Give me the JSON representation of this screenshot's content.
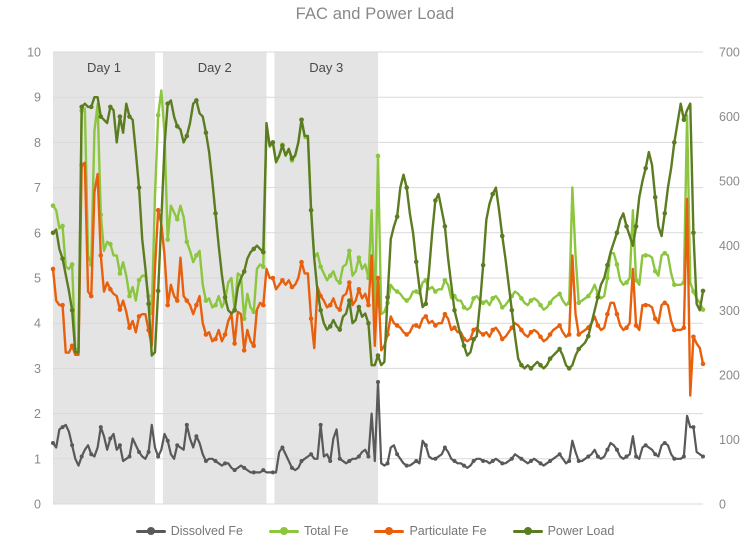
{
  "chart": {
    "title": "FAC and Power Load",
    "title_color": "#888888"
  },
  "axes": {
    "left": {
      "ticks": [
        "0",
        "1",
        "2",
        "3",
        "4",
        "5",
        "6",
        "7",
        "8",
        "9",
        "10"
      ],
      "min": 0,
      "max": 10,
      "step": 1
    },
    "right": {
      "ticks": [
        "0",
        "100",
        "200",
        "300",
        "400",
        "500",
        "600",
        "700"
      ],
      "min": 0,
      "max": 700,
      "step": 100
    }
  },
  "bands": [
    {
      "label": "Day 1",
      "x_start": 0,
      "x_end": 32
    },
    {
      "label": "Day 2",
      "x_start": 34.5,
      "x_end": 67
    },
    {
      "label": "Day 3",
      "x_start": 69.5,
      "x_end": 102
    }
  ],
  "band_color": "#e4e4e4",
  "legend": {
    "position": "bottom",
    "items": [
      {
        "label": "Dissolved Fe",
        "color": "#595959"
      },
      {
        "label": "Total Fe",
        "color": "#8CC63E"
      },
      {
        "label": "Particulate Fe",
        "color": "#E8600D"
      },
      {
        "label": "Power Load",
        "color": "#5C7C22"
      }
    ]
  },
  "chart_data": {
    "type": "line",
    "title": "FAC and Power Load",
    "xlabel": "",
    "ylabel": "",
    "ylim": [
      0,
      10
    ],
    "y2lim": [
      0,
      700
    ],
    "grid": true,
    "legend_position": "bottom",
    "annotations": [
      "Day 1",
      "Day 2",
      "Day 3"
    ],
    "series": [
      {
        "name": "Total Fe",
        "color": "#8CC63E",
        "axis": "left",
        "values": [
          6.6,
          6.5,
          6.1,
          6.15,
          5.25,
          5.2,
          5.3,
          3.4,
          3.45,
          8.7,
          8.75,
          5.5,
          5.3,
          8.25,
          8.85,
          6.4,
          5.6,
          5.8,
          5.75,
          5.5,
          5.5,
          5.1,
          5.35,
          5.05,
          4.6,
          4.8,
          4.5,
          4.95,
          5.05,
          5.05,
          4.6,
          4.2,
          6.8,
          8.6,
          9.15,
          8.2,
          5.85,
          6.6,
          6.45,
          6.3,
          6.6,
          6.35,
          5.8,
          5.6,
          5.35,
          5.5,
          5.6,
          4.85,
          4.5,
          4.55,
          4.35,
          4.4,
          4.6,
          4.35,
          4.5,
          4.9,
          5.0,
          4.3,
          5.1,
          5.05,
          4.1,
          4.65,
          4.35,
          4.25,
          5.2,
          5.3,
          5.25,
          8.35,
          7.9,
          8.0,
          7.55,
          7.7,
          7.95,
          7.7,
          7.85,
          7.6,
          7.7,
          8.0,
          8.5,
          8.1,
          8.1,
          6.5,
          5.45,
          5.55,
          5.25,
          5.1,
          4.95,
          5.05,
          5.15,
          4.95,
          4.9,
          5.25,
          5.3,
          5.6,
          5.05,
          5.15,
          5.45,
          5.2,
          5.3,
          5.0,
          6.5,
          4.2,
          7.7,
          4.2,
          4.25,
          4.45,
          4.85,
          4.75,
          4.7,
          4.65,
          4.55,
          4.5,
          4.55,
          4.7,
          4.7,
          4.65,
          4.9,
          4.95,
          4.75,
          4.8,
          4.7,
          4.75,
          4.75,
          4.95,
          4.85,
          4.55,
          4.6,
          4.5,
          4.5,
          4.35,
          4.3,
          4.35,
          4.55,
          4.6,
          4.5,
          4.45,
          4.5,
          4.4,
          4.55,
          4.6,
          4.5,
          4.35,
          4.4,
          4.5,
          4.6,
          4.7,
          4.65,
          4.55,
          4.45,
          4.4,
          4.5,
          4.55,
          4.5,
          4.4,
          4.3,
          4.35,
          4.45,
          4.55,
          4.6,
          4.65,
          4.5,
          4.4,
          4.45,
          7.0,
          5.5,
          4.45,
          4.5,
          4.55,
          4.6,
          4.7,
          4.85,
          4.65,
          4.55,
          4.6,
          5.0,
          5.55,
          5.55,
          5.3,
          4.95,
          4.85,
          4.9,
          5.0,
          6.5,
          4.95,
          4.85,
          5.5,
          5.5,
          5.5,
          5.45,
          5.15,
          5.05,
          5.5,
          5.55,
          5.5,
          5.1,
          4.85,
          4.85,
          4.85,
          4.9,
          8.6,
          4.9,
          4.7,
          4.55,
          4.45,
          4.3
        ]
      },
      {
        "name": "Particulate Fe",
        "color": "#E8600D",
        "axis": "left",
        "values": [
          5.2,
          4.5,
          4.4,
          4.4,
          3.35,
          3.35,
          3.5,
          3.3,
          3.3,
          7.5,
          7.55,
          4.7,
          4.6,
          6.9,
          7.3,
          5.5,
          4.7,
          4.9,
          4.75,
          4.65,
          4.6,
          4.3,
          4.5,
          4.25,
          3.9,
          4.05,
          3.8,
          4.15,
          4.2,
          4.2,
          3.85,
          3.5,
          5.2,
          6.5,
          6.2,
          5.5,
          4.4,
          4.85,
          4.6,
          4.5,
          5.45,
          4.6,
          4.5,
          4.4,
          4.2,
          4.4,
          4.6,
          4.0,
          3.75,
          3.8,
          3.6,
          3.65,
          3.85,
          3.6,
          3.75,
          4.05,
          4.2,
          3.55,
          4.25,
          4.2,
          3.4,
          3.85,
          3.6,
          3.5,
          4.3,
          4.45,
          4.4,
          5.2,
          5.0,
          5.0,
          4.75,
          4.85,
          4.95,
          4.85,
          4.95,
          4.8,
          4.85,
          5.0,
          5.35,
          5.1,
          5.1,
          4.1,
          3.45,
          4.8,
          4.6,
          4.5,
          4.35,
          4.4,
          4.55,
          4.35,
          4.3,
          4.6,
          4.65,
          4.9,
          4.4,
          4.5,
          4.75,
          4.55,
          4.65,
          4.4,
          5.5,
          3.5,
          5.0,
          3.4,
          3.5,
          3.75,
          4.15,
          4.0,
          3.95,
          3.9,
          3.8,
          3.75,
          3.8,
          3.95,
          3.95,
          3.9,
          4.1,
          4.15,
          4.0,
          4.05,
          3.95,
          4.0,
          4.0,
          4.2,
          4.1,
          3.85,
          3.9,
          3.8,
          3.8,
          3.65,
          3.6,
          3.65,
          3.85,
          3.9,
          3.8,
          3.75,
          3.8,
          3.7,
          3.85,
          3.9,
          3.8,
          3.65,
          3.7,
          3.8,
          3.9,
          4.0,
          3.95,
          3.85,
          3.75,
          3.7,
          3.8,
          3.85,
          3.8,
          3.7,
          3.6,
          3.65,
          3.75,
          3.85,
          3.9,
          3.95,
          3.8,
          3.7,
          3.75,
          5.5,
          4.2,
          3.75,
          3.8,
          3.85,
          3.9,
          4.0,
          4.15,
          3.95,
          3.85,
          3.9,
          4.2,
          4.45,
          4.45,
          4.2,
          3.95,
          3.85,
          3.9,
          4.0,
          5.2,
          3.95,
          3.85,
          4.4,
          4.4,
          4.4,
          4.35,
          4.1,
          4.0,
          4.4,
          4.45,
          4.4,
          4.05,
          3.85,
          3.85,
          3.85,
          3.9,
          6.75,
          2.4,
          3.7,
          3.55,
          3.45,
          3.1
        ]
      },
      {
        "name": "Power Load",
        "color": "#5C7C22",
        "axis": "right",
        "values": [
          420,
          425,
          395,
          380,
          355,
          330,
          300,
          235,
          235,
          615,
          620,
          615,
          615,
          630,
          630,
          600,
          595,
          590,
          615,
          610,
          560,
          600,
          575,
          620,
          600,
          595,
          545,
          490,
          410,
          365,
          310,
          230,
          235,
          330,
          440,
          555,
          620,
          625,
          600,
          585,
          580,
          560,
          570,
          590,
          620,
          625,
          605,
          600,
          575,
          545,
          500,
          450,
          400,
          355,
          320,
          300,
          295,
          300,
          335,
          350,
          360,
          380,
          390,
          395,
          400,
          395,
          390,
          590,
          555,
          560,
          530,
          540,
          555,
          540,
          550,
          535,
          540,
          560,
          595,
          570,
          570,
          455,
          380,
          330,
          300,
          280,
          270,
          275,
          285,
          275,
          270,
          290,
          295,
          315,
          280,
          285,
          305,
          290,
          295,
          280,
          215,
          215,
          230,
          215,
          220,
          320,
          410,
          430,
          445,
          490,
          510,
          490,
          450,
          420,
          375,
          335,
          305,
          310,
          360,
          420,
          470,
          480,
          455,
          430,
          380,
          340,
          300,
          280,
          260,
          245,
          230,
          235,
          255,
          260,
          310,
          370,
          440,
          465,
          480,
          490,
          455,
          415,
          380,
          340,
          300,
          260,
          225,
          215,
          210,
          215,
          210,
          215,
          220,
          215,
          210,
          215,
          225,
          230,
          235,
          240,
          230,
          215,
          210,
          215,
          230,
          240,
          245,
          250,
          260,
          280,
          300,
          320,
          340,
          350,
          370,
          390,
          405,
          420,
          440,
          450,
          430,
          415,
          400,
          430,
          475,
          500,
          520,
          545,
          525,
          475,
          430,
          415,
          450,
          490,
          520,
          560,
          590,
          620,
          595,
          610,
          620,
          420,
          310,
          300,
          330
        ]
      },
      {
        "name": "Dissolved Fe",
        "color": "#595959",
        "axis": "left",
        "values": [
          1.35,
          1.25,
          1.65,
          1.7,
          1.75,
          1.6,
          1.3,
          1.0,
          0.85,
          1.05,
          1.2,
          1.3,
          1.1,
          1.05,
          1.25,
          1.7,
          1.5,
          1.2,
          1.45,
          1.55,
          1.2,
          1.3,
          0.95,
          1.0,
          1.05,
          1.45,
          1.3,
          1.15,
          1.05,
          1.0,
          1.15,
          1.75,
          1.25,
          1.05,
          1.2,
          1.55,
          1.4,
          1.1,
          1.0,
          1.3,
          1.25,
          1.2,
          1.75,
          1.45,
          1.25,
          1.5,
          1.35,
          1.1,
          0.95,
          1.0,
          1.0,
          0.95,
          0.9,
          0.85,
          0.9,
          0.9,
          0.8,
          0.75,
          0.8,
          0.85,
          0.8,
          0.75,
          0.7,
          0.7,
          0.7,
          0.7,
          0.75,
          0.7,
          0.7,
          0.7,
          0.7,
          1.15,
          1.25,
          1.1,
          0.95,
          0.8,
          0.75,
          0.8,
          0.95,
          1.0,
          1.05,
          1.1,
          1.0,
          1.0,
          1.75,
          1.05,
          1.1,
          0.95,
          1.45,
          1.65,
          1.0,
          0.95,
          0.9,
          0.95,
          1.0,
          1.0,
          1.05,
          1.15,
          1.2,
          1.05,
          2.0,
          0.95,
          2.7,
          0.9,
          0.85,
          0.9,
          1.25,
          1.3,
          1.1,
          1.0,
          0.9,
          0.85,
          0.85,
          0.9,
          0.95,
          0.9,
          1.4,
          1.3,
          1.05,
          1.0,
          1.0,
          1.05,
          1.1,
          1.25,
          1.15,
          1.0,
          0.95,
          0.9,
          0.9,
          0.85,
          0.8,
          0.85,
          0.95,
          1.0,
          1.0,
          0.95,
          0.95,
          0.9,
          0.95,
          1.0,
          0.95,
          0.9,
          0.9,
          0.95,
          1.0,
          1.1,
          1.05,
          1.0,
          0.95,
          0.9,
          0.95,
          1.0,
          0.95,
          0.9,
          0.85,
          0.9,
          0.95,
          1.0,
          1.05,
          1.1,
          1.0,
          0.9,
          0.95,
          1.4,
          1.15,
          0.95,
          0.95,
          1.0,
          1.05,
          1.1,
          1.2,
          1.05,
          1.0,
          1.05,
          1.2,
          1.35,
          1.3,
          1.2,
          1.05,
          1.0,
          1.05,
          1.1,
          1.5,
          1.05,
          1.0,
          1.25,
          1.3,
          1.25,
          1.2,
          1.1,
          1.05,
          1.3,
          1.35,
          1.3,
          1.1,
          1.0,
          1.0,
          1.0,
          1.05,
          1.95,
          1.7,
          1.7,
          1.15,
          1.1,
          1.05
        ]
      }
    ]
  }
}
